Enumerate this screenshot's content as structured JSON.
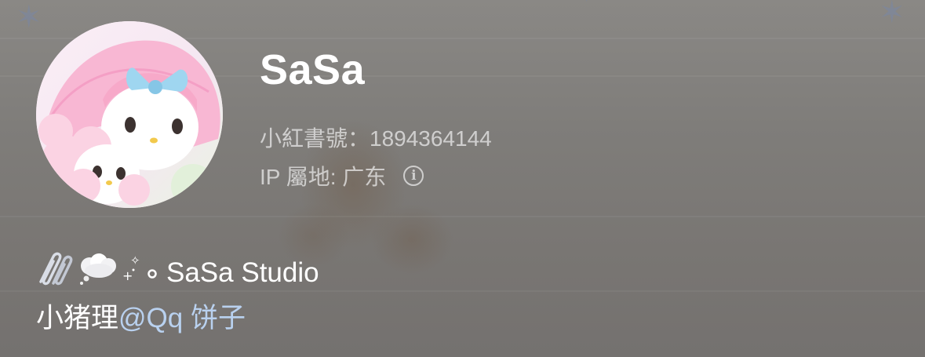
{
  "profile": {
    "name": "SaSa",
    "id_text": "小紅書號：1894364144",
    "ip_text": "IP 屬地: 广东"
  },
  "bio": {
    "line1_text": "SaSa Studio",
    "line2_prefix": "小猪理",
    "line2_mention": "@Qq 饼子"
  },
  "icons": {
    "info": "info-circle-icon",
    "paperclip": "paperclip-icon",
    "thought_bubble": "thought-bubble-icon",
    "sparkles": "sparkle-icon"
  },
  "colors": {
    "mention": "#b9d1ef",
    "background": "#7f7c79"
  }
}
